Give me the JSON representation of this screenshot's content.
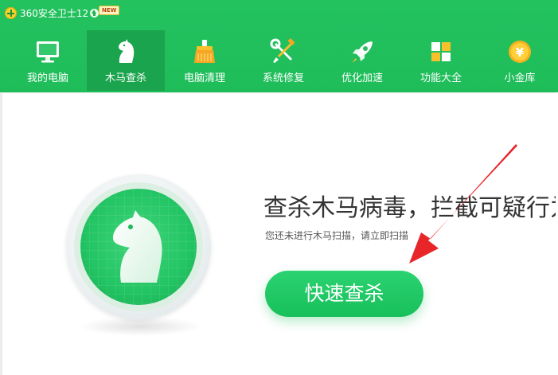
{
  "titlebar": {
    "title": "360安全卫士12",
    "badge": "NEW"
  },
  "tabs": [
    {
      "label": "我的电脑",
      "icon": "monitor-icon",
      "active": false
    },
    {
      "label": "木马查杀",
      "icon": "horse-icon",
      "active": true
    },
    {
      "label": "电脑清理",
      "icon": "broom-icon",
      "active": false
    },
    {
      "label": "系统修复",
      "icon": "wrench-screwdriver-icon",
      "active": false
    },
    {
      "label": "优化加速",
      "icon": "rocket-icon",
      "active": false
    },
    {
      "label": "功能大全",
      "icon": "grid-apps-icon",
      "active": false
    },
    {
      "label": "小金库",
      "icon": "coin-icon",
      "active": false
    }
  ],
  "main": {
    "headline": "查杀木马病毒，拦截可疑行为",
    "subtitle": "您还未进行木马扫描，请立即扫描",
    "scan_button": "快速查杀"
  },
  "colors": {
    "brand_green": "#23c25f",
    "active_tab": "#1aa44d",
    "annotation_arrow": "#e8262a"
  }
}
